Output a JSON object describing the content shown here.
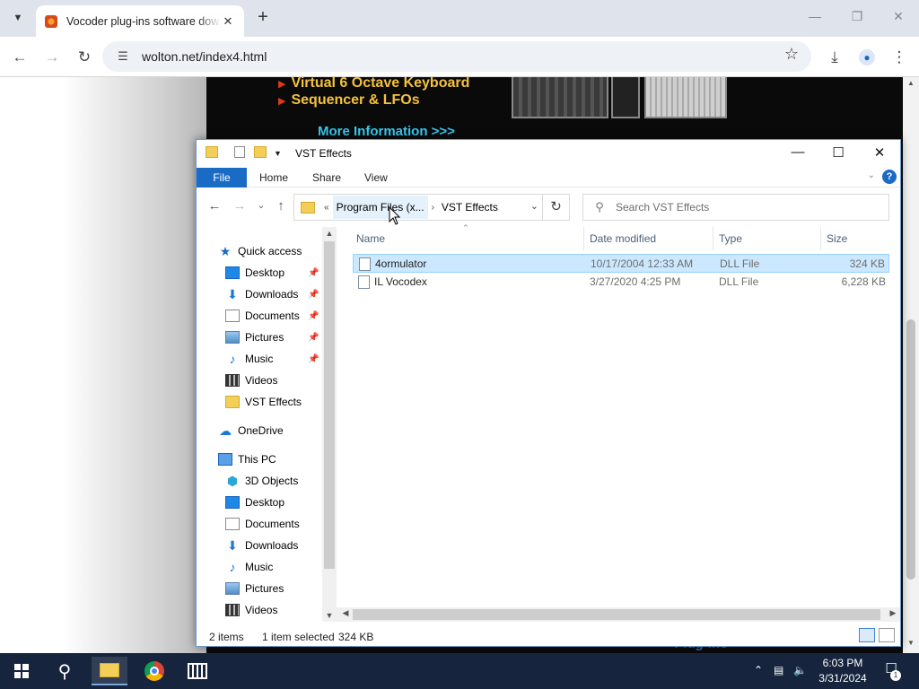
{
  "browser": {
    "tab_title": "Vocoder plug-ins software download",
    "tab_close": "✕",
    "new_tab": "+",
    "url": "wolton.net/index4.html",
    "win_min": "—",
    "win_max": "❐",
    "win_close": "✕"
  },
  "page": {
    "promo_lines": [
      "Virtual 6 Octave Keyboard",
      "Sequencer & LFOs"
    ],
    "more_info": "More Information >>>",
    "footer_text": "Plug-ins"
  },
  "explorer": {
    "title": "VST Effects",
    "ribbon": {
      "file": "File",
      "home": "Home",
      "share": "Share",
      "view": "View",
      "help": "?"
    },
    "address": {
      "overflow": "«",
      "crumb1": "Program Files (x...",
      "crumb2": "VST Effects"
    },
    "search": {
      "placeholder": "Search VST Effects"
    },
    "nav": {
      "quick_access": "Quick access",
      "desktop": "Desktop",
      "downloads": "Downloads",
      "documents": "Documents",
      "pictures": "Pictures",
      "music": "Music",
      "videos": "Videos",
      "vst_effects": "VST Effects",
      "onedrive": "OneDrive",
      "this_pc": "This PC",
      "objects3d": "3D Objects",
      "pc_desktop": "Desktop",
      "pc_documents": "Documents",
      "pc_downloads": "Downloads",
      "pc_music": "Music",
      "pc_pictures": "Pictures",
      "pc_videos": "Videos"
    },
    "columns": {
      "name": "Name",
      "date": "Date modified",
      "type": "Type",
      "size": "Size"
    },
    "files": [
      {
        "name": "4ormulator",
        "date": "10/17/2004 12:33 AM",
        "type": "DLL File",
        "size": "324 KB",
        "selected": true
      },
      {
        "name": "IL Vocodex",
        "date": "3/27/2020 4:25 PM",
        "type": "DLL File",
        "size": "6,228 KB",
        "selected": false
      }
    ],
    "status": {
      "items": "2 items",
      "selected": "1 item selected",
      "size": "324 KB"
    }
  },
  "taskbar": {
    "time": "6:03 PM",
    "date": "3/31/2024",
    "notification_count": "1"
  },
  "colors": {
    "accent": "#1a6bc5",
    "selection": "#cce8ff",
    "taskbar": "#16253d",
    "promo_text": "#f5c23c",
    "link_text": "#39c8f0"
  }
}
